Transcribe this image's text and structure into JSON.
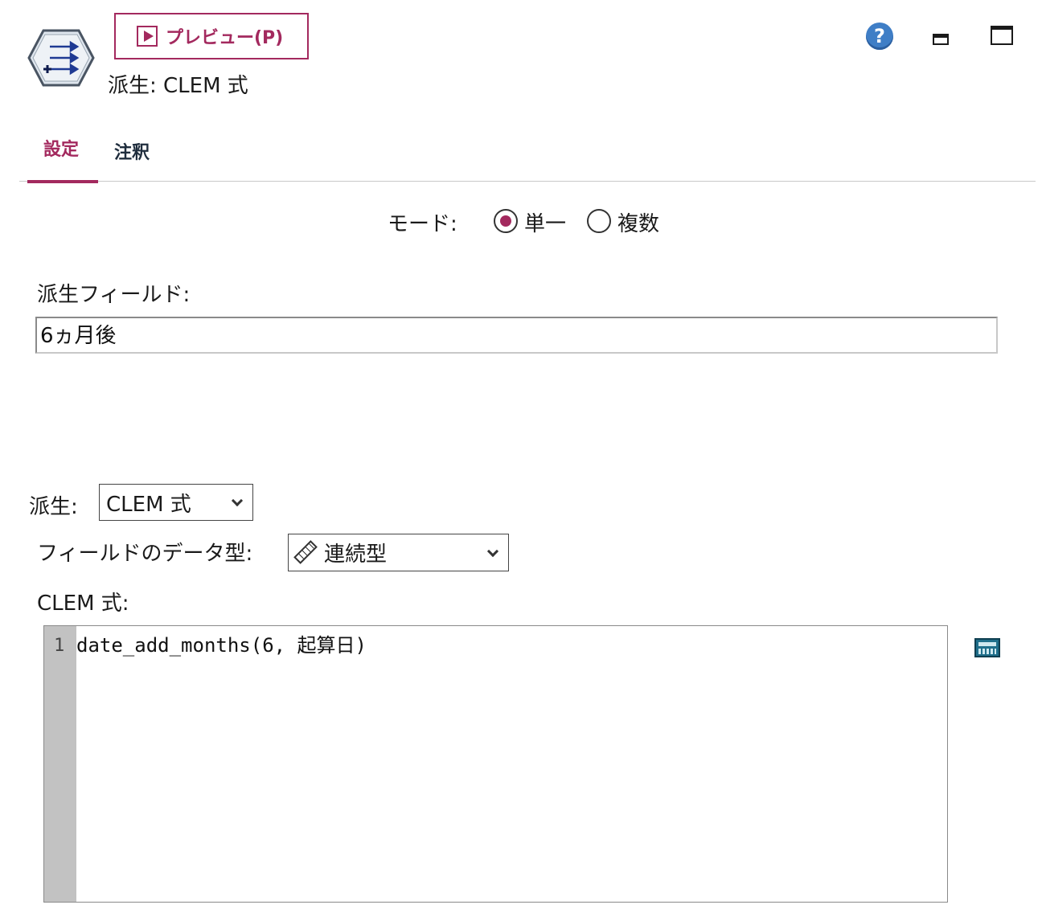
{
  "header": {
    "preview_label": "プレビュー(P)",
    "node_title": "派生: CLEM 式",
    "icons": [
      "derive-node-icon",
      "play-icon",
      "help-icon",
      "minimize-icon",
      "maximize-icon"
    ]
  },
  "tabs": [
    {
      "label": "設定",
      "active": true
    },
    {
      "label": "注釈",
      "active": false
    }
  ],
  "mode": {
    "label": "モード:",
    "options": [
      {
        "label": "単一",
        "selected": true
      },
      {
        "label": "複数",
        "selected": false
      }
    ]
  },
  "derived_field": {
    "label": "派生フィールド:",
    "value": "6ヵ月後"
  },
  "derive_as": {
    "label": "派生:",
    "value": "CLEM 式"
  },
  "field_type": {
    "label": "フィールドのデータ型:",
    "value": "連続型",
    "icon": "ruler-icon"
  },
  "expression": {
    "label": "CLEM 式:",
    "line_number": "1",
    "code": "date_add_months(6, 起算日)",
    "builder_icon": "calculator-icon"
  },
  "colors": {
    "accent": "#a3295e",
    "help_blue": "#3f7ec6",
    "gutter": "#c2c2c2"
  }
}
